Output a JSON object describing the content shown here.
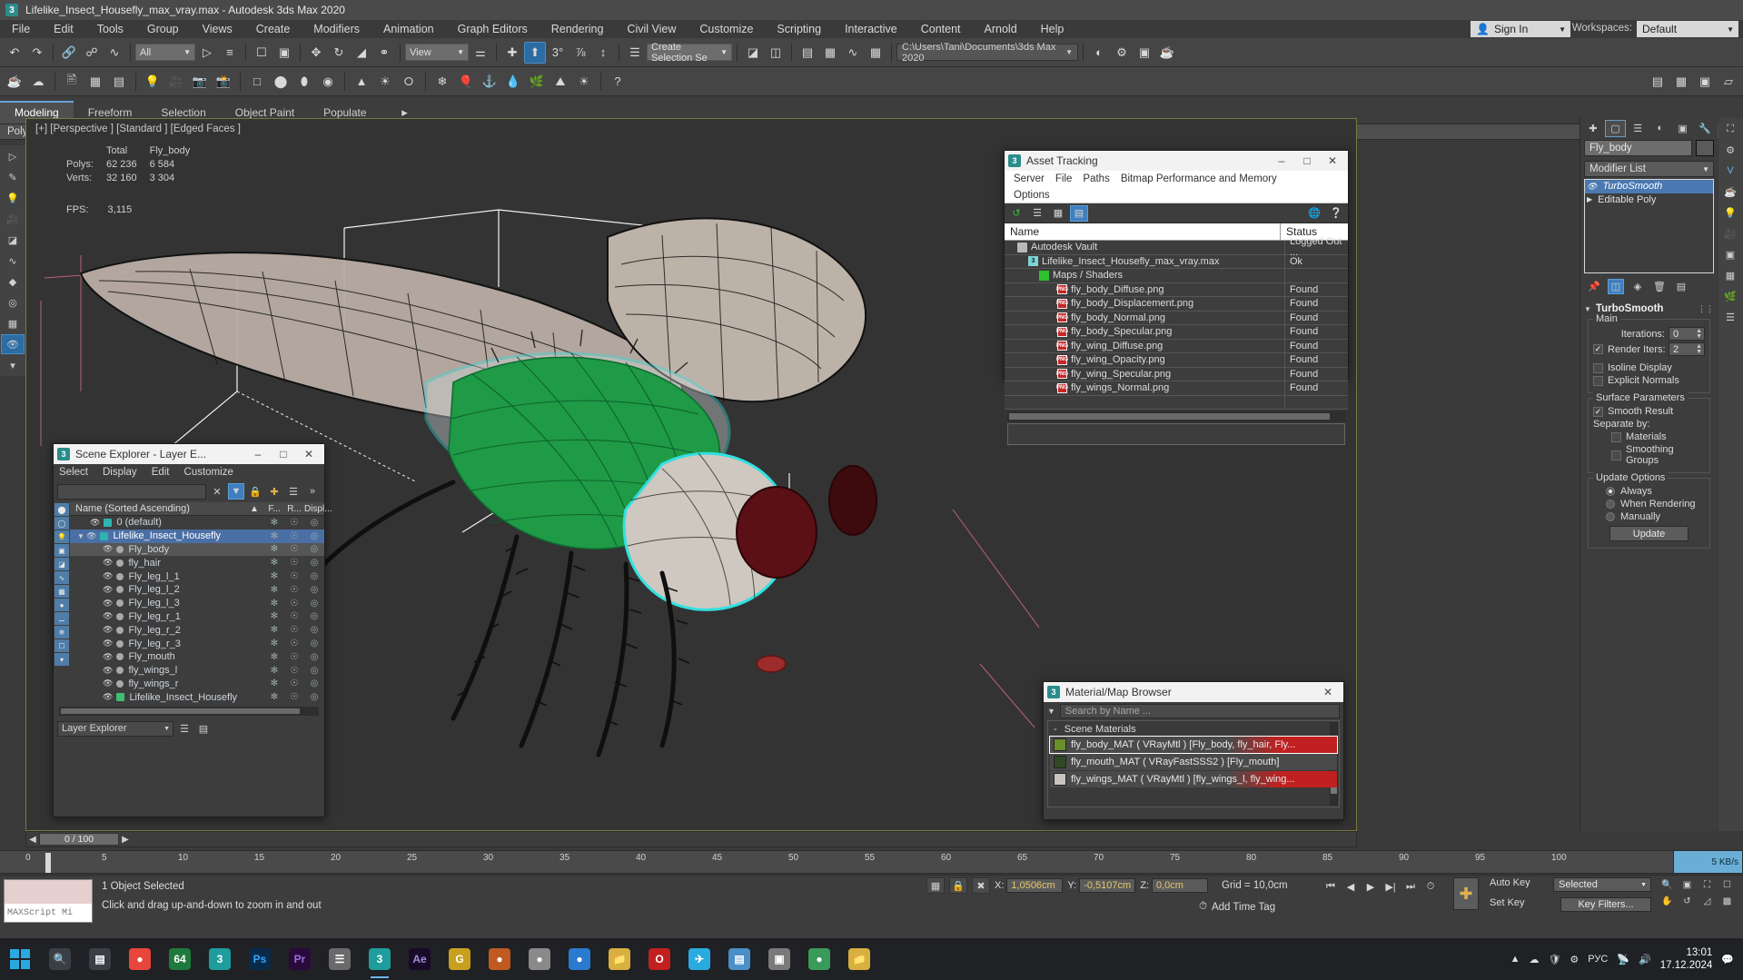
{
  "titlebar": {
    "icon": "3dsmax-icon",
    "title": "Lifelike_Insect_Housefly_max_vray.max - Autodesk 3ds Max 2020"
  },
  "menubar": {
    "items": [
      "File",
      "Edit",
      "Tools",
      "Group",
      "Views",
      "Create",
      "Modifiers",
      "Animation",
      "Graph Editors",
      "Rendering",
      "Civil View",
      "Customize",
      "Scripting",
      "Interactive",
      "Content",
      "Arnold",
      "Help"
    ],
    "sign_in": "Sign In",
    "workspaces_label": "Workspaces:",
    "workspace_value": "Default"
  },
  "toolbar": {
    "selection_filter": "All",
    "reference_coord": "View",
    "project_path": "C:\\Users\\Tani\\Documents\\3ds Max 2020"
  },
  "ribbon": {
    "tabs": [
      "Modeling",
      "Freeform",
      "Selection",
      "Object Paint",
      "Populate"
    ],
    "active_tab": "Modeling",
    "subtitle": "Polygon Modeling"
  },
  "viewport": {
    "label": "[+] [Perspective ] [Standard ] [Edged Faces ]",
    "stats": {
      "col_headers": [
        "",
        "Total",
        "Fly_body"
      ],
      "rows": [
        {
          "label": "Polys:",
          "total": "62 236",
          "object": "6 584"
        },
        {
          "label": "Verts:",
          "total": "32 160",
          "object": "3 304"
        }
      ],
      "fps_label": "FPS:",
      "fps_value": "3,115"
    }
  },
  "asset_tracking": {
    "title": "Asset Tracking",
    "menus": [
      "Server",
      "File",
      "Paths",
      "Bitmap Performance and Memory",
      "Options"
    ],
    "columns": [
      "Name",
      "Status"
    ],
    "rows": [
      {
        "name": "Autodesk Vault",
        "status": "Logged Out ...",
        "icon": "vault-icon",
        "indent": 0
      },
      {
        "name": "Lifelike_Insect_Housefly_max_vray.max",
        "status": "Ok",
        "icon": "max-file-icon",
        "indent": 1
      },
      {
        "name": "Maps / Shaders",
        "status": "",
        "icon": "maps-icon",
        "indent": 2
      },
      {
        "name": "fly_body_Diffuse.png",
        "status": "Found",
        "icon": "png-icon",
        "indent": 3
      },
      {
        "name": "fly_body_Displacement.png",
        "status": "Found",
        "icon": "png-icon",
        "indent": 3
      },
      {
        "name": "fly_body_Normal.png",
        "status": "Found",
        "icon": "png-icon",
        "indent": 3
      },
      {
        "name": "fly_body_Specular.png",
        "status": "Found",
        "icon": "png-icon",
        "indent": 3
      },
      {
        "name": "fly_wing_Diffuse.png",
        "status": "Found",
        "icon": "png-icon",
        "indent": 3
      },
      {
        "name": "fly_wing_Opacity.png",
        "status": "Found",
        "icon": "png-icon",
        "indent": 3
      },
      {
        "name": "fly_wing_Specular.png",
        "status": "Found",
        "icon": "png-icon",
        "indent": 3
      },
      {
        "name": "fly_wings_Normal.png",
        "status": "Found",
        "icon": "png-icon",
        "indent": 3
      }
    ]
  },
  "scene_explorer": {
    "title": "Scene Explorer - Layer E...",
    "menus": [
      "Select",
      "Display",
      "Edit",
      "Customize"
    ],
    "search_value": "",
    "columns": [
      "Name (Sorted Ascending)",
      "F...",
      "R...",
      "Displ..."
    ],
    "items": [
      {
        "label": "0 (default)",
        "type": "layer",
        "indent": 1,
        "state": "normal"
      },
      {
        "label": "Lifelike_Insect_Housefly",
        "type": "layer",
        "indent": 1,
        "state": "selected"
      },
      {
        "label": "Fly_body",
        "type": "object",
        "indent": 2,
        "state": "highlight"
      },
      {
        "label": "fly_hair",
        "type": "object",
        "indent": 2,
        "state": "normal"
      },
      {
        "label": "Fly_leg_l_1",
        "type": "object",
        "indent": 2,
        "state": "normal"
      },
      {
        "label": "Fly_leg_l_2",
        "type": "object",
        "indent": 2,
        "state": "normal"
      },
      {
        "label": "Fly_leg_l_3",
        "type": "object",
        "indent": 2,
        "state": "normal"
      },
      {
        "label": "Fly_leg_r_1",
        "type": "object",
        "indent": 2,
        "state": "normal"
      },
      {
        "label": "Fly_leg_r_2",
        "type": "object",
        "indent": 2,
        "state": "normal"
      },
      {
        "label": "Fly_leg_r_3",
        "type": "object",
        "indent": 2,
        "state": "normal"
      },
      {
        "label": "Fly_mouth",
        "type": "object",
        "indent": 2,
        "state": "normal"
      },
      {
        "label": "fly_wings_l",
        "type": "object",
        "indent": 2,
        "state": "normal"
      },
      {
        "label": "fly_wings_r",
        "type": "object",
        "indent": 2,
        "state": "normal"
      },
      {
        "label": "Lifelike_Insect_Housefly",
        "type": "group",
        "indent": 2,
        "state": "normal"
      }
    ],
    "footer_select": "Layer Explorer"
  },
  "material_browser": {
    "title": "Material/Map Browser",
    "search_placeholder": "Search by Name ...",
    "group_label": "Scene Materials",
    "items": [
      {
        "name": "fly_body_MAT ( VRayMtl )  [Fly_body, fly_hair, Fly...",
        "flagged": true,
        "selected": true,
        "swatch": "#6b8f2a"
      },
      {
        "name": "fly_mouth_MAT ( VRayFastSSS2 )  [Fly_mouth]",
        "flagged": false,
        "selected": false,
        "swatch": "#2f4a22"
      },
      {
        "name": "fly_wings_MAT ( VRayMtl )  [fly_wings_l, fly_wing...",
        "flagged": true,
        "selected": false,
        "swatch": "#c9c4bd"
      }
    ]
  },
  "command_panel": {
    "object_name": "Fly_body",
    "modifier_list_label": "Modifier List",
    "stack": [
      {
        "label": "TurboSmooth",
        "active": true
      },
      {
        "label": "Editable Poly",
        "active": false
      }
    ],
    "rollout_title": "TurboSmooth",
    "groups": {
      "main": {
        "title": "Main",
        "iterations_label": "Iterations:",
        "iterations_value": "0",
        "render_iters_label": "Render Iters:",
        "render_iters_value": "2",
        "render_iters_checked": true,
        "isoline_label": "Isoline Display",
        "isoline_checked": false,
        "explicit_label": "Explicit Normals",
        "explicit_checked": false
      },
      "surface": {
        "title": "Surface Parameters",
        "smooth_result_label": "Smooth Result",
        "smooth_result_checked": true,
        "separate_label": "Separate by:",
        "materials_label": "Materials",
        "materials_checked": false,
        "smoothing_groups_label": "Smoothing Groups",
        "smoothing_groups_checked": false
      },
      "update": {
        "title": "Update Options",
        "options": [
          "Always",
          "When Rendering",
          "Manually"
        ],
        "selected": "Always",
        "button": "Update"
      }
    }
  },
  "timeline": {
    "current_frame": "0 / 100",
    "ticks": [
      "0",
      "5",
      "10",
      "15",
      "20",
      "25",
      "30",
      "35",
      "40",
      "45",
      "50",
      "55",
      "60",
      "65",
      "70",
      "75",
      "80",
      "85",
      "90",
      "95",
      "100"
    ],
    "memory": "5 KB/s"
  },
  "statusbar": {
    "maxscript_label": "MAXScript Mi",
    "selection_status": "1 Object Selected",
    "prompt": "Click and drag up-and-down to zoom in and out",
    "coords": {
      "x_label": "X:",
      "x_value": "1,0506cm",
      "y_label": "Y:",
      "y_value": "-0,5107cm",
      "z_label": "Z:",
      "z_value": "0,0cm"
    },
    "grid": "Grid = 10,0cm",
    "add_time_tag": "Add Time Tag",
    "auto_key": "Auto Key",
    "set_key": "Set Key",
    "selected_filter": "Selected",
    "key_filters": "Key Filters..."
  },
  "taskbar": {
    "apps": [
      {
        "name": "start-button",
        "label": ""
      },
      {
        "name": "search-icon",
        "label": ""
      },
      {
        "name": "task-view-icon",
        "label": ""
      },
      {
        "name": "chrome-icon",
        "label": ""
      },
      {
        "name": "64-app-icon",
        "label": "64"
      },
      {
        "name": "3dsmax-icon",
        "label": "3"
      },
      {
        "name": "photoshop-icon",
        "label": "Ps"
      },
      {
        "name": "premiere-icon",
        "label": "Pr"
      },
      {
        "name": "notes-icon",
        "label": ""
      },
      {
        "name": "3dsmax-active-icon",
        "label": "3"
      },
      {
        "name": "aftereffects-icon",
        "label": "Ae"
      },
      {
        "name": "substance-icon",
        "label": "G"
      },
      {
        "name": "marmoset-icon",
        "label": ""
      },
      {
        "name": "zbrush-icon",
        "label": ""
      },
      {
        "name": "blender-icon",
        "label": ""
      },
      {
        "name": "explorer-icon",
        "label": ""
      },
      {
        "name": "opera-icon",
        "label": "O"
      },
      {
        "name": "telegram-icon",
        "label": ""
      },
      {
        "name": "calc-icon",
        "label": ""
      },
      {
        "name": "viewer-icon",
        "label": ""
      },
      {
        "name": "unity-icon",
        "label": ""
      },
      {
        "name": "folder-icon",
        "label": ""
      }
    ],
    "language": "РУС",
    "time": "13:01",
    "date": "17.12.2024"
  },
  "colors": {
    "accent_blue": "#3f7fbf",
    "selection_cyan": "#32e0e0",
    "body_green": "#1f9a46",
    "status_yellow": "#e8c96a",
    "flag_red": "#c02020"
  }
}
